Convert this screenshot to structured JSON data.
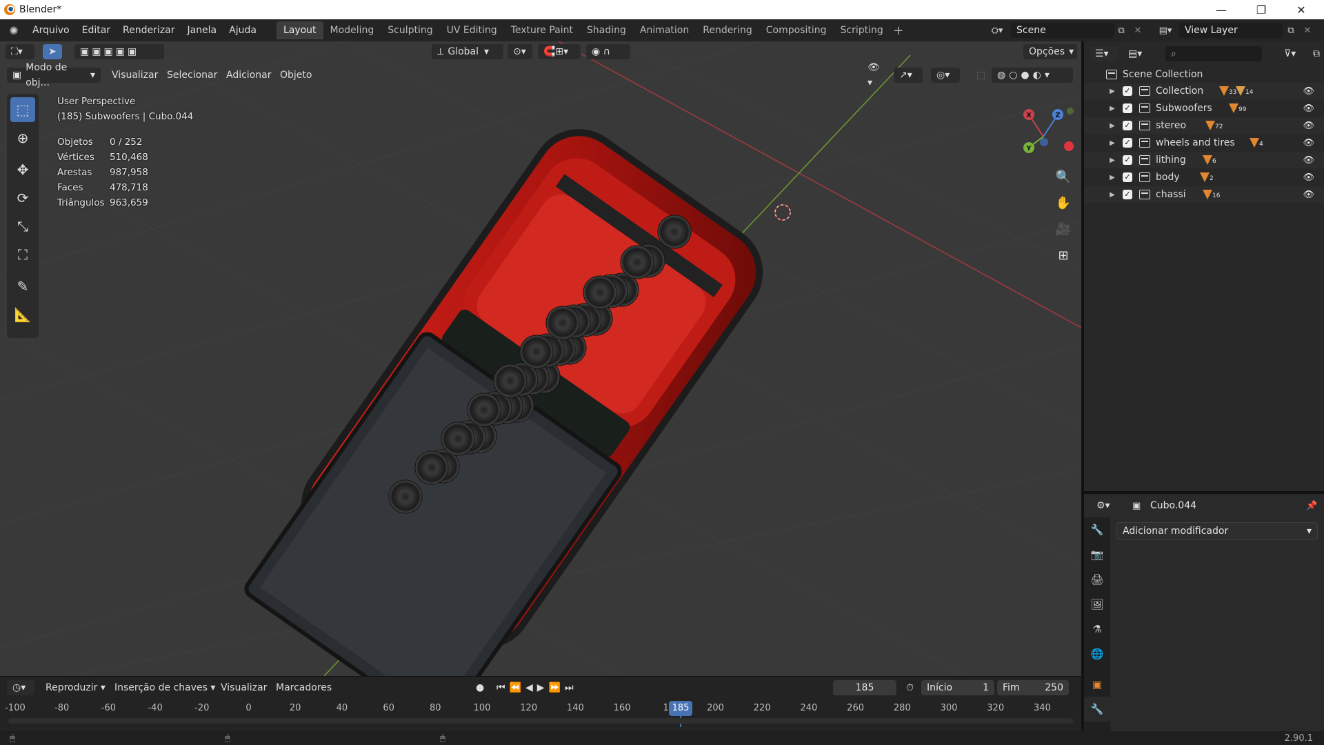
{
  "window": {
    "title": "Blender*",
    "minimize": "—",
    "maximize": "❐",
    "close": "✕"
  },
  "menus": [
    "Arquivo",
    "Editar",
    "Renderizar",
    "Janela",
    "Ajuda"
  ],
  "workspaces": [
    "Layout",
    "Modeling",
    "Sculpting",
    "UV Editing",
    "Texture Paint",
    "Shading",
    "Animation",
    "Rendering",
    "Compositing",
    "Scripting"
  ],
  "active_workspace": "Layout",
  "scene": {
    "name": "Scene",
    "view_layer": "View Layer"
  },
  "viewport": {
    "orientation": "Global",
    "options_label": "Opções",
    "mode": "Modo de obj...",
    "menus": [
      "Visualizar",
      "Selecionar",
      "Adicionar",
      "Objeto"
    ],
    "perspective": "User Perspective",
    "active": "(185) Subwoofers | Cubo.044",
    "stats": [
      {
        "label": "Objetos",
        "value": "0 / 252"
      },
      {
        "label": "Vértices",
        "value": "510,468"
      },
      {
        "label": "Arestas",
        "value": "987,958"
      },
      {
        "label": "Faces",
        "value": "478,718"
      },
      {
        "label": "Triângulos",
        "value": "963,659"
      }
    ],
    "gizmo_labels": {
      "x": "X",
      "y": "Y",
      "z": "Z"
    }
  },
  "outliner": {
    "root": "Scene Collection",
    "collections": [
      {
        "name": "Collection",
        "badge": "33",
        "badge2": "14"
      },
      {
        "name": "Subwoofers",
        "badge": "99"
      },
      {
        "name": "stereo",
        "badge": "72"
      },
      {
        "name": "wheels and tires",
        "badge": "4"
      },
      {
        "name": "lithing",
        "badge": "6"
      },
      {
        "name": "body",
        "badge": "2"
      },
      {
        "name": "chassi",
        "badge": "16"
      }
    ]
  },
  "properties": {
    "object": "Cubo.044",
    "add_modifier": "Adicionar modificador"
  },
  "timeline": {
    "menus": [
      "Reproduzir",
      "Inserção de chaves",
      "Visualizar",
      "Marcadores"
    ],
    "current_frame": "185",
    "start_label": "Início",
    "start": "1",
    "end_label": "Fim",
    "end": "250",
    "ticks": [
      "-100",
      "-80",
      "-60",
      "-40",
      "-20",
      "0",
      "20",
      "40",
      "60",
      "80",
      "100",
      "120",
      "140",
      "160",
      "18",
      "200",
      "220",
      "240",
      "260",
      "280",
      "300",
      "320",
      "340"
    ]
  },
  "status": {
    "version": "2.90.1"
  }
}
